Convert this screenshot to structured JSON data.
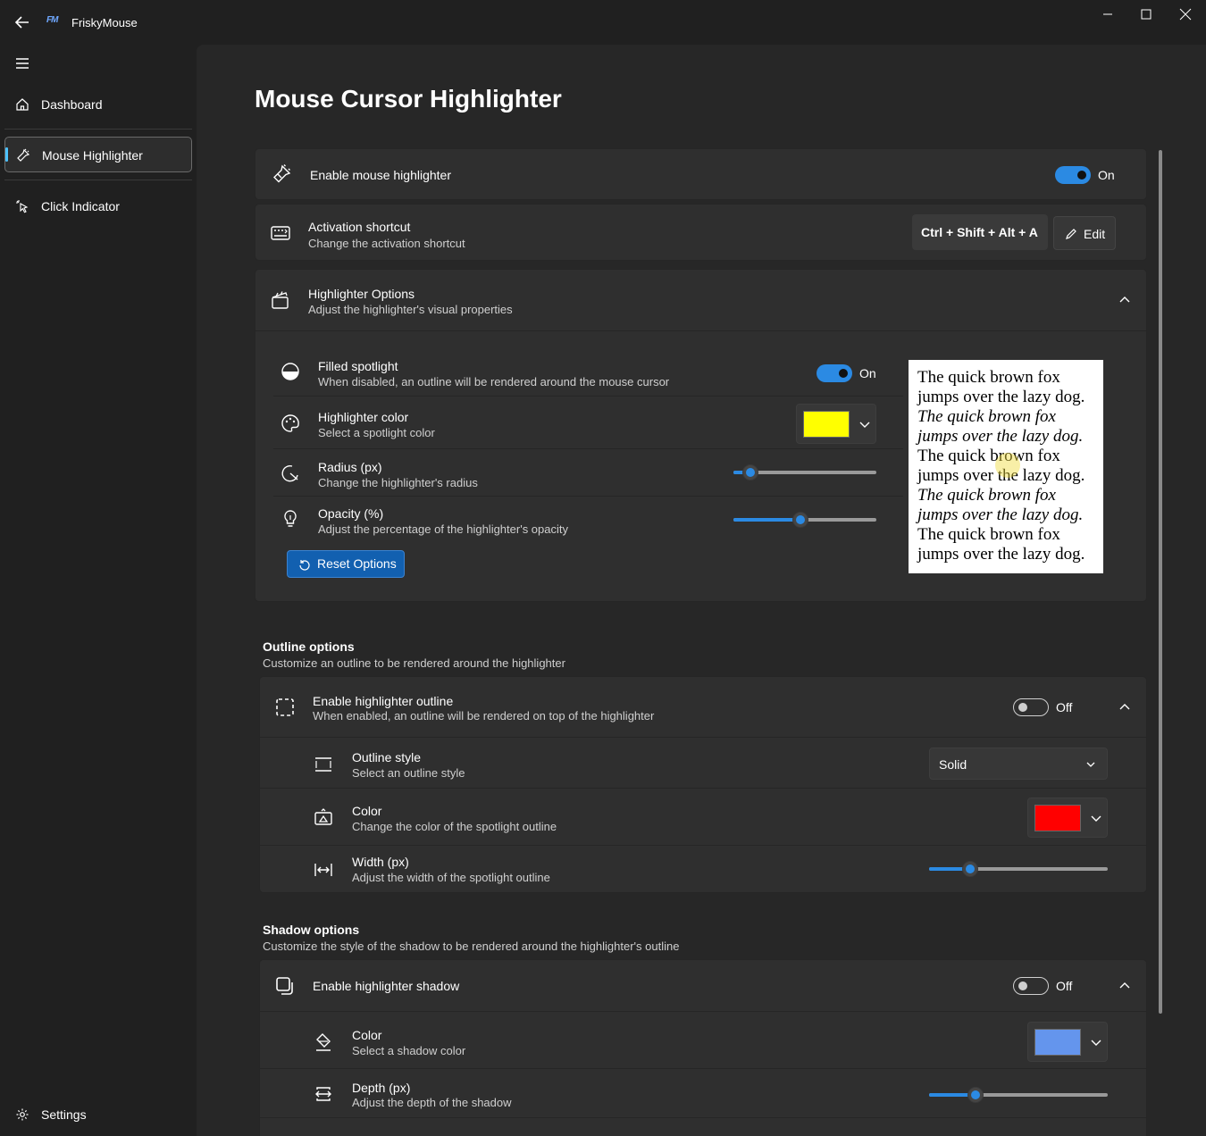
{
  "titlebar": {
    "app_title": "FriskyMouse",
    "logo": "FM"
  },
  "sidebar": {
    "items": [
      {
        "label": "Dashboard",
        "icon": "home-icon"
      },
      {
        "label": "Mouse Highlighter",
        "icon": "flashlight-icon"
      },
      {
        "label": "Click Indicator",
        "icon": "cursor-click-icon"
      }
    ],
    "settings_label": "Settings"
  },
  "page": {
    "title": "Mouse Cursor Highlighter"
  },
  "enable": {
    "title": "Enable mouse highlighter",
    "state": "On"
  },
  "shortcut": {
    "title": "Activation shortcut",
    "subtitle": "Change the activation shortcut",
    "keys": "Ctrl + Shift + Alt + A",
    "edit_label": "Edit"
  },
  "options": {
    "title": "Highlighter Options",
    "subtitle": "Adjust the highlighter's visual properties",
    "filled": {
      "title": "Filled spotlight",
      "subtitle": "When disabled, an outline will be rendered around the mouse cursor",
      "state": "On"
    },
    "color": {
      "title": "Highlighter color",
      "subtitle": "Select a spotlight color",
      "value": "#ffff00"
    },
    "radius": {
      "title": "Radius (px)",
      "subtitle": "Change the highlighter's radius",
      "level": 0.12
    },
    "opacity": {
      "title": "Opacity (%)",
      "subtitle": "Adjust the percentage of the highlighter's opacity",
      "level": 0.47
    },
    "reset_label": "Reset Options",
    "preview_lines": [
      {
        "text": "The quick brown fox",
        "italic": false
      },
      {
        "text": "jumps over the lazy dog.",
        "italic": false
      },
      {
        "text": "The quick brown fox",
        "italic": true
      },
      {
        "text": "jumps over the lazy dog.",
        "italic": true
      },
      {
        "text": "The quick brown fox",
        "italic": false
      },
      {
        "text": "jumps over the lazy dog.",
        "italic": false
      },
      {
        "text": "The quick brown fox",
        "italic": true
      },
      {
        "text": "jumps over the lazy dog.",
        "italic": true
      },
      {
        "text": "The quick brown fox",
        "italic": false
      },
      {
        "text": "jumps over the lazy dog.",
        "italic": false
      }
    ]
  },
  "outline": {
    "section_title": "Outline options",
    "section_subtitle": "Customize an outline to be rendered around the highlighter",
    "enable": {
      "title": "Enable highlighter outline",
      "subtitle": "When enabled, an outline will be rendered on top of the highlighter",
      "state": "Off"
    },
    "style": {
      "title": "Outline style",
      "subtitle": "Select an outline style",
      "value": "Solid"
    },
    "color": {
      "title": "Color",
      "subtitle": "Change the color of the spotlight outline",
      "value": "#ff0000"
    },
    "width": {
      "title": "Width (px)",
      "subtitle": "Adjust the width of the spotlight outline",
      "level": 0.23
    }
  },
  "shadow": {
    "section_title": "Shadow options",
    "section_subtitle": "Customize the style of the shadow to be rendered around the highlighter's outline",
    "enable": {
      "title": "Enable highlighter shadow",
      "state": "Off"
    },
    "color": {
      "title": "Color",
      "subtitle": "Select a shadow color",
      "value": "#6495ed"
    },
    "depth": {
      "title": "Depth (px)",
      "subtitle": "Adjust the depth of the shadow",
      "level": 0.26
    }
  },
  "colors": {
    "accent": "#2b8ae3",
    "background": "#202020",
    "card": "#2f2f2f"
  }
}
